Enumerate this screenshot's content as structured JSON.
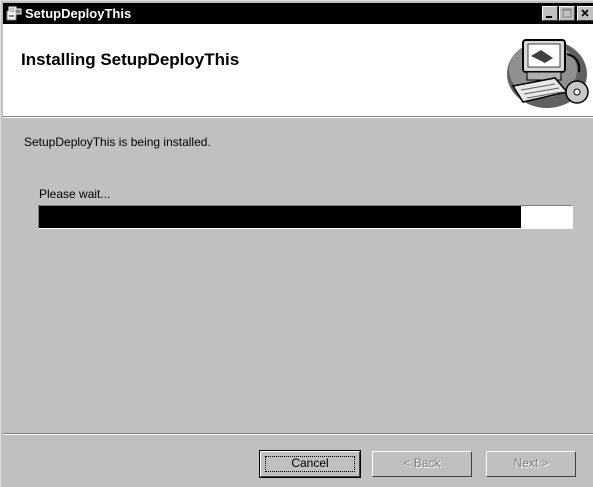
{
  "window": {
    "title": "SetupDeployThis",
    "minimize_label": "_",
    "maximize_label": "□",
    "close_label": "×"
  },
  "banner": {
    "heading": "Installing SetupDeployThis",
    "art_icon": "computer-install-icon"
  },
  "body": {
    "status": "SetupDeployThis is being installed.",
    "wait": "Please wait...",
    "progress_fraction": 0.905
  },
  "buttons": {
    "cancel": "Cancel",
    "back": "< Back",
    "next": "Next >"
  },
  "colors": {
    "titlebar": "#000000",
    "dialog": "#c0c0c0",
    "banner": "#ffffff",
    "progress_fill": "#000000"
  }
}
